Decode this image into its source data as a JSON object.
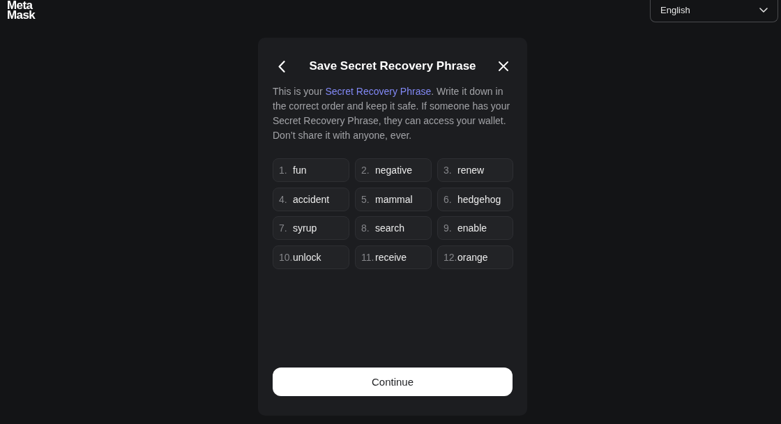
{
  "logo": {
    "lines": [
      "Meta",
      "Mask"
    ]
  },
  "language_select": {
    "value": "English"
  },
  "dialog": {
    "title": "Save Secret Recovery Phrase",
    "description": {
      "before": "This is your ",
      "link": "Secret Recovery Phrase",
      "after": ". Write it down in the correct order and keep it safe. If someone has your Secret Recovery Phrase, they can access your wallet. Don’t share it with anyone, ever."
    },
    "words": [
      {
        "number": "1.",
        "word": "fun"
      },
      {
        "number": "2.",
        "word": "negative"
      },
      {
        "number": "3.",
        "word": "renew"
      },
      {
        "number": "4.",
        "word": "accident"
      },
      {
        "number": "5.",
        "word": "mammal"
      },
      {
        "number": "6.",
        "word": "hedgehog"
      },
      {
        "number": "7.",
        "word": "syrup"
      },
      {
        "number": "8.",
        "word": "search"
      },
      {
        "number": "9.",
        "word": "enable"
      },
      {
        "number": "10.",
        "word": "unlock"
      },
      {
        "number": "11.",
        "word": "receive"
      },
      {
        "number": "12.",
        "word": "orange"
      }
    ],
    "continue_button": "Continue"
  }
}
